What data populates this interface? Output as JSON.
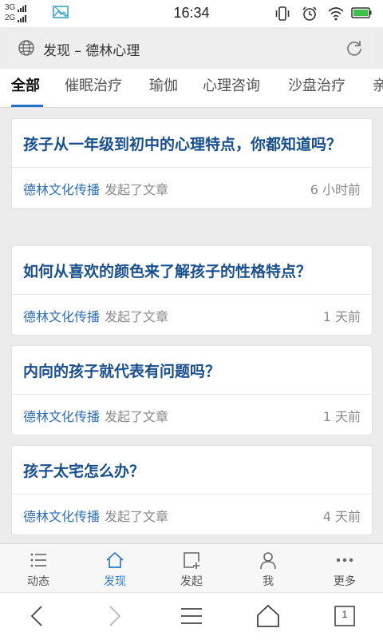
{
  "status_bar": {
    "network_1": "3G",
    "network_2": "2G",
    "time": "16:34"
  },
  "address_bar": {
    "title": "发现 – 德林心理"
  },
  "tabs": [
    {
      "label": "全部"
    },
    {
      "label": "催眠治疗"
    },
    {
      "label": "瑜伽"
    },
    {
      "label": "心理咨询"
    },
    {
      "label": "沙盘治疗"
    },
    {
      "label": "亲"
    }
  ],
  "articles": [
    {
      "title": "孩子从一年级到初中的心理特点，你都知道吗？",
      "author": "德林文化传播",
      "action": "发起了文章",
      "time": "6 小时前"
    },
    {
      "title": "如何从喜欢的颜色来了解孩子的性格特点？",
      "author": "德林文化传播",
      "action": "发起了文章",
      "time": "1 天前"
    },
    {
      "title": "内向的孩子就代表有问题吗？",
      "author": "德林文化传播",
      "action": "发起了文章",
      "time": "1 天前"
    },
    {
      "title": "孩子太宅怎么办？",
      "author": "德林文化传播",
      "action": "发起了文章",
      "time": "4 天前"
    }
  ],
  "bottom_nav": [
    {
      "label": "动态",
      "icon": "list-icon"
    },
    {
      "label": "发现",
      "icon": "home-icon"
    },
    {
      "label": "发起",
      "icon": "compose-icon"
    },
    {
      "label": "我",
      "icon": "user-icon"
    },
    {
      "label": "更多",
      "icon": "more-icon"
    }
  ],
  "browser_bar": {
    "tab_count": "1"
  },
  "colors": {
    "accent": "#2f7ac8",
    "title_blue": "#1a4f8d",
    "battery_green": "#3cc24a"
  }
}
